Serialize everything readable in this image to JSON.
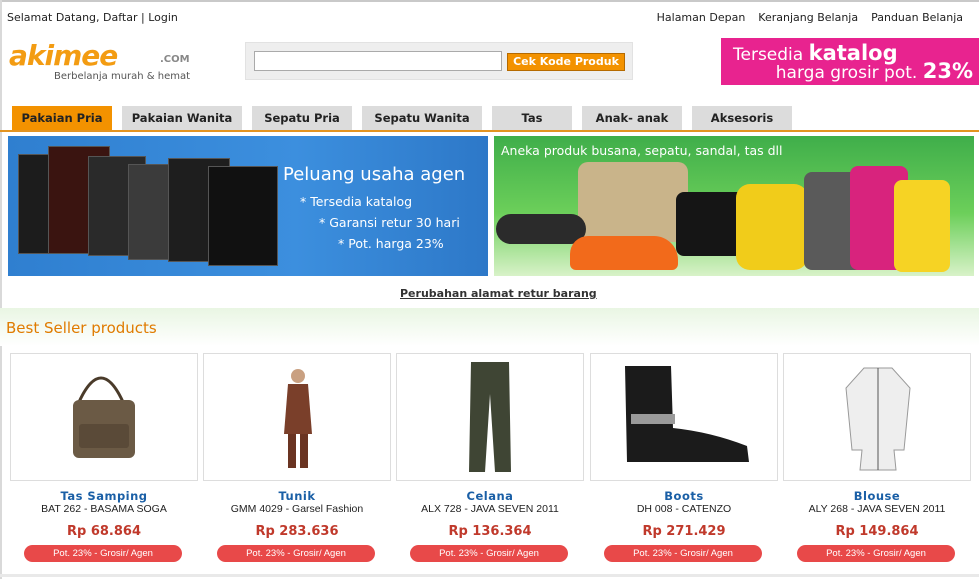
{
  "topbar": {
    "welcome": "Selamat Datang,",
    "register": "Daftar",
    "separator": "|",
    "login": "Login",
    "links": [
      "Halaman Depan",
      "Keranjang Belanja",
      "Panduan Belanja"
    ]
  },
  "logo": {
    "word": "akimee",
    "suffix": ".COM",
    "tagline": "Berbelanja murah & hemat"
  },
  "search": {
    "value": "",
    "placeholder": "",
    "button": "Cek Kode Produk"
  },
  "promo": {
    "line1_a": "Tersedia ",
    "line1_b": "katalog",
    "line2_a": "harga grosir pot. ",
    "line2_b": "23%"
  },
  "nav": [
    "Pakaian Pria",
    "Pakaian Wanita",
    "Sepatu Pria",
    "Sepatu Wanita",
    "Tas",
    "Anak- anak",
    "Aksesoris"
  ],
  "banner1": {
    "title": "Peluang usaha agen",
    "bullets": [
      "* Tersedia katalog",
      "* Garansi retur 30 hari",
      "* Pot. harga 23%"
    ]
  },
  "banner2": {
    "caption": "Aneka produk busana, sepatu, sandal, tas dll"
  },
  "retur_link": "Perubahan alamat retur barang",
  "section_title": "Best Seller products",
  "products": [
    {
      "name": "Tas Samping",
      "code": "BAT 262 - BASAMA SOGA",
      "price": "Rp 68.864",
      "badge": "Pot. 23% - Grosir/ Agen"
    },
    {
      "name": "Tunik",
      "code": "GMM 4029 - Garsel Fashion",
      "price": "Rp 283.636",
      "badge": "Pot. 23% - Grosir/ Agen"
    },
    {
      "name": "Celana",
      "code": "ALX 728 - JAVA SEVEN 2011",
      "price": "Rp 136.364",
      "badge": "Pot. 23% - Grosir/ Agen"
    },
    {
      "name": "Boots",
      "code": "DH 008 - CATENZO",
      "price": "Rp 271.429",
      "badge": "Pot. 23% - Grosir/ Agen"
    },
    {
      "name": "Blouse",
      "code": "ALY 268 - JAVA SEVEN 2011",
      "price": "Rp 149.864",
      "badge": "Pot. 23% - Grosir/ Agen"
    }
  ],
  "colors": {
    "accent": "#f39200",
    "promo": "#e8238f",
    "price": "#c0392b",
    "product_name": "#1a5fa6"
  }
}
